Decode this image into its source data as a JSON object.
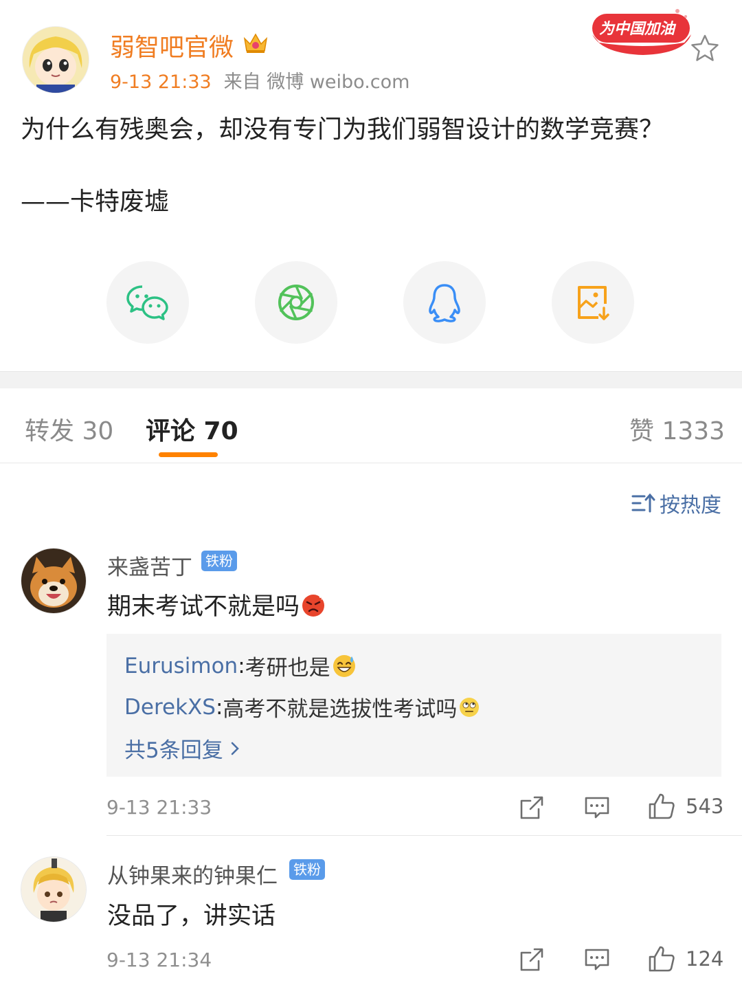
{
  "post": {
    "username": "弱智吧官微",
    "time": "9-13 21:33",
    "source": "来自 微博 weibo.com",
    "text": "为什么有残奥会，却没有专门为我们弱智设计的数学竞赛？",
    "author_line": "——卡特废墟",
    "promo_label": "为中国加油"
  },
  "share": {
    "icons": [
      "wechat-icon",
      "moments-icon",
      "qq-icon",
      "save-image-icon"
    ]
  },
  "tabs": {
    "repost": "转发 30",
    "comments": "评论 70",
    "likes": "赞 1333"
  },
  "sort_label": "按热度",
  "comments": [
    {
      "name": "来盏苦丁",
      "badge": "铁粉",
      "text": "期末考试不就是吗",
      "replies": [
        {
          "user": "Eurusimon",
          "sep": ": ",
          "text": "考研也是"
        },
        {
          "user": "DerekXS",
          "sep": ": ",
          "text": "高考不就是选拔性考试吗"
        }
      ],
      "more_replies": "共5条回复 ",
      "time": "9-13 21:33",
      "likes": "543"
    },
    {
      "name": "从钟果来的钟果仁",
      "badge": "铁粉",
      "text": "没品了，讲实话",
      "time": "9-13 21:34",
      "likes": "124"
    }
  ],
  "colors": {
    "accent_orange": "#ff8200",
    "name_orange": "#f07d22",
    "link_blue": "#4a6fa5",
    "badge_blue": "#5a9bea"
  }
}
